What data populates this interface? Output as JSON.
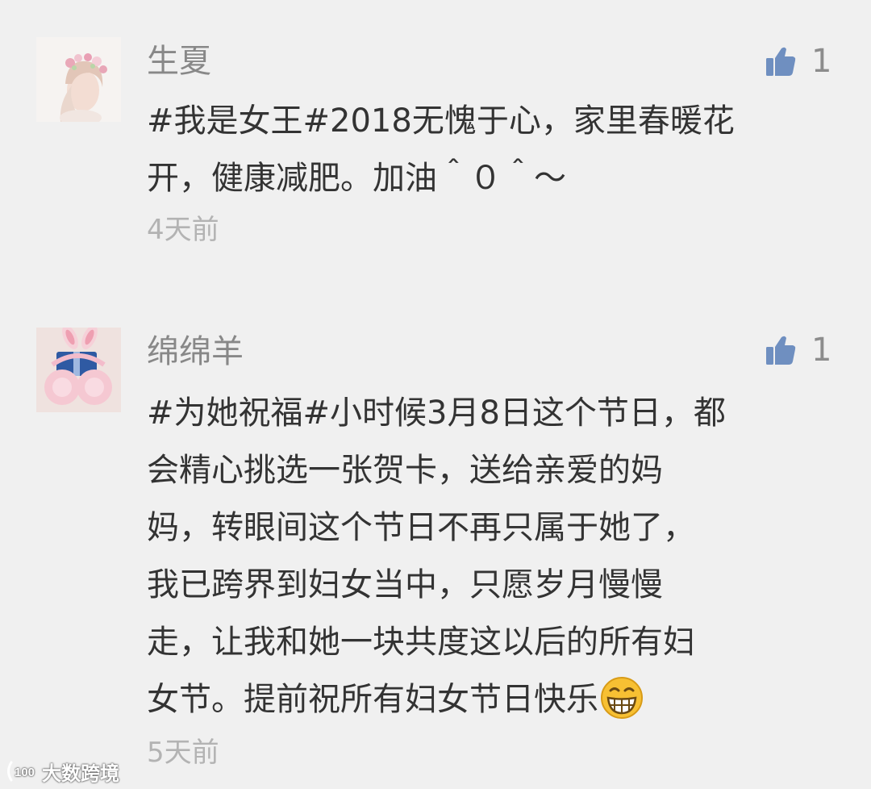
{
  "comments": [
    {
      "username": "生夏",
      "avatar_icon": "avatar-girl-flower-crown",
      "likes": "1",
      "lines": [
        "#我是女王#2018无愧于心，家里春暖花",
        "开，健康减肥。加油＾０＾～"
      ],
      "time": "4天前"
    },
    {
      "username": "绵绵羊",
      "avatar_icon": "avatar-pink-bunny-earmuffs",
      "likes": "1",
      "lines": [
        "#为她祝福#小时候3月8日这个节日，都",
        "会精心挑选一张贺卡，送给亲爱的妈",
        "妈，转眼间这个节日不再只属于她了，",
        "我已跨界到妇女当中，只愿岁月慢慢",
        "走，让我和她一块共度这以后的所有妇",
        "女节。提前祝所有妇女节日快乐"
      ],
      "emoji": "grin-emoji",
      "time": "5天前"
    }
  ],
  "watermark": {
    "text": "大数跨境",
    "logo_text": "100"
  },
  "colors": {
    "background": "#f0f0f0",
    "username": "#888888",
    "body_text": "#333333",
    "time": "#b3b3b3",
    "like_icon": "#6f8fc0"
  }
}
